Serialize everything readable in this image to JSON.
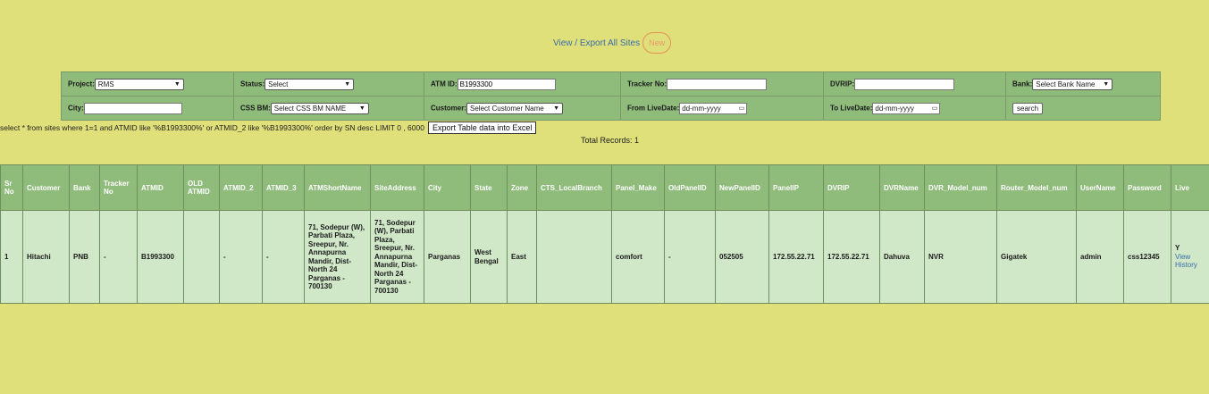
{
  "top_links": {
    "view_export": "View / Export All Sites",
    "new_badge": "New"
  },
  "filters": {
    "project_label": "Project:",
    "project_value": "RMS",
    "status_label": "Status:",
    "status_value": "Select",
    "atmid_label": "ATM ID:",
    "atmid_value": "B1993300",
    "tracker_label": "Tracker No:",
    "tracker_value": "",
    "dvrip_label": "DVRIP:",
    "dvrip_value": "",
    "bank_label": "Bank:",
    "bank_value": "Select Bank Name",
    "city_label": "City:",
    "city_value": "",
    "cssbm_label": "CSS BM:",
    "cssbm_value": "Select CSS BM NAME",
    "customer_label": "Customer:",
    "customer_value": "Select Customer Name",
    "fromlive_label": "From LiveDate:",
    "fromlive_value": "dd-mm-yyyy",
    "tolive_label": "To LiveDate:",
    "tolive_value": "dd-mm-yyyy",
    "search_label": "search"
  },
  "query": {
    "text": "select * from sites where 1=1 and ATMID like '%B1993300%' or ATMID_2 like '%B1993300%' order by SN desc LIMIT 0 , 6000",
    "export_label": "Export Table data into Excel",
    "total_records": "Total Records: 1"
  },
  "table": {
    "headers": [
      "Sr No",
      "Customer",
      "Bank",
      "Tracker No",
      "ATMID",
      "OLD ATMID",
      "ATMID_2",
      "ATMID_3",
      "ATMShortName",
      "SiteAddress",
      "City",
      "State",
      "Zone",
      "CTS_LocalBranch",
      "Panel_Make",
      "OldPanelID",
      "NewPanelID",
      "PanelIP",
      "DVRIP",
      "DVRName",
      "DVR_Model_num",
      "Router_Model_num",
      "UserName",
      "Password",
      "Live"
    ],
    "rows": [
      {
        "cells": [
          "1",
          "Hitachi",
          "PNB",
          "-",
          "B1993300",
          "",
          "-",
          "-",
          "71, Sodepur (W), Parbati Plaza, Sreepur, Nr. Annapurna Mandir, Dist- North 24 Parganas - 700130",
          "71, Sodepur (W), Parbati Plaza, Sreepur, Nr. Annapurna Mandir, Dist- North 24 Parganas - 700130",
          "Parganas",
          "West Bengal",
          "East",
          "",
          "comfort",
          "-",
          "052505",
          "172.55.22.71",
          "172.55.22.71",
          "Dahuva",
          "NVR",
          "Gigatek",
          "admin",
          "css12345",
          "Y"
        ],
        "view_history": "View History"
      }
    ]
  }
}
